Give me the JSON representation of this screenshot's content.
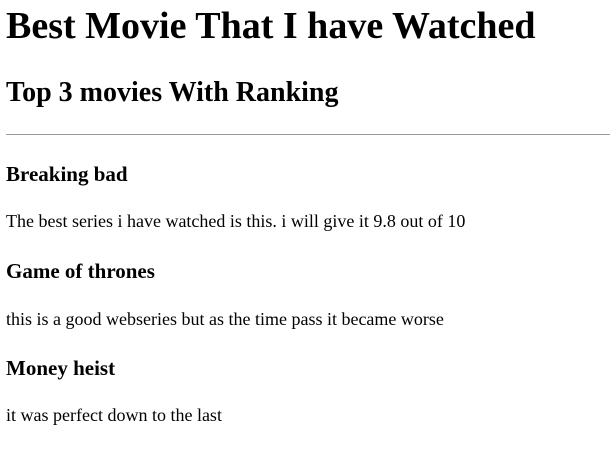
{
  "header": {
    "title": "Best Movie That I have Watched",
    "subtitle": "Top 3 movies With Ranking"
  },
  "movies": [
    {
      "title": "Breaking bad",
      "description": "The best series i have watched is this. i will give it 9.8 out of 10"
    },
    {
      "title": "Game of thrones",
      "description": "this is a good webseries but as the time pass it became worse"
    },
    {
      "title": "Money heist",
      "description": "it was perfect down to the last"
    }
  ]
}
